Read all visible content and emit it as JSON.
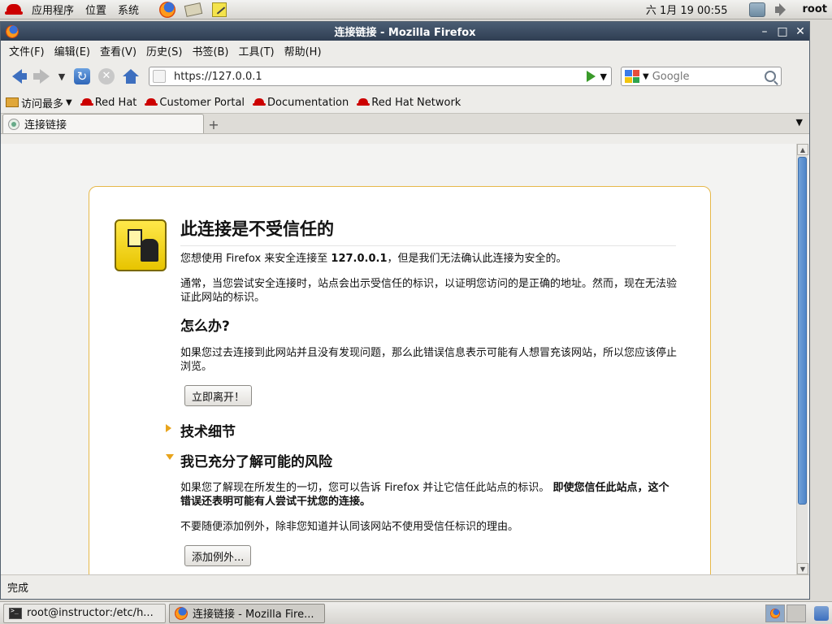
{
  "top_panel": {
    "menus": [
      "应用程序",
      "位置",
      "系统"
    ],
    "clock": "六 1月 19 00:55",
    "user": "root"
  },
  "window": {
    "title": "连接链接 - Mozilla Firefox"
  },
  "menubar": [
    "文件(F)",
    "编辑(E)",
    "查看(V)",
    "历史(S)",
    "书签(B)",
    "工具(T)",
    "帮助(H)"
  ],
  "navbar": {
    "url": "https://127.0.0.1",
    "search_placeholder": "Google"
  },
  "bookmarks": {
    "most_visited": "访问最多",
    "items": [
      "Red Hat",
      "Customer Portal",
      "Documentation",
      "Red Hat Network"
    ]
  },
  "tab": {
    "label": "连接链接"
  },
  "error_page": {
    "title": "此连接是不受信任的",
    "p1_prefix": "您想使用 Firefox 来安全连接至 ",
    "p1_host": "127.0.0.1",
    "p1_suffix": "，但是我们无法确认此连接为安全的。",
    "p2": "通常，当您尝试安全连接时，站点会出示受信任的标识，以证明您访问的是正确的地址。然而，现在无法验证此网站的标识。",
    "what_to_do": "怎么办?",
    "p3": "如果您过去连接到此网站并且没有发现问题，那么此错误信息表示可能有人想冒充该网站，所以您应该停止浏览。",
    "leave_button": "立即离开！",
    "tech_details": "技术细节",
    "understand_risks": "我已充分了解可能的风险",
    "p4_normal": "如果您了解现在所发生的一切，您可以告诉 Firefox 并让它信任此站点的标识。",
    "p4_bold": "即使您信任此站点，这个错误还表明可能有人尝试干扰您的连接。",
    "p5": "不要随便添加例外，除非您知道并认同该网站不使用受信任标识的理由。",
    "add_exception_button": "添加例外..."
  },
  "statusbar": {
    "text": "完成"
  },
  "taskbar": {
    "tasks": [
      "root@instructor:/etc/h...",
      "连接链接 - Mozilla Fire..."
    ]
  },
  "colors": {
    "titlebar": "#3a4b60",
    "error_border": "#e6b84a",
    "twisty": "#e8a41c",
    "scroll_thumb": "#5a8fd0"
  }
}
